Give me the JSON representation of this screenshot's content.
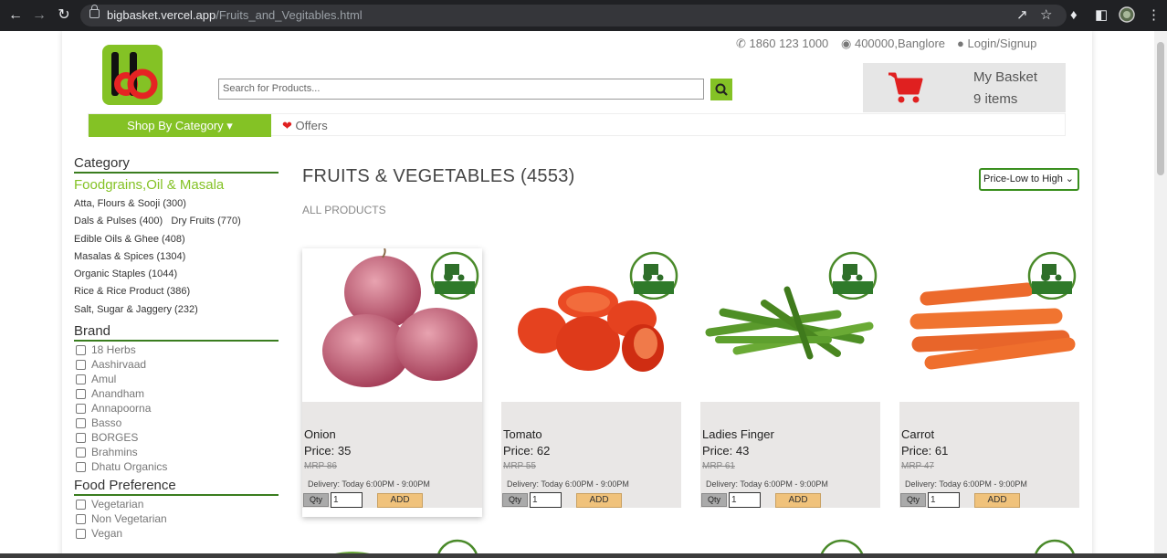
{
  "browser": {
    "url_domain": "bigbasket.vercel.app",
    "url_path": "/Fruits_and_Vegitables.html"
  },
  "header": {
    "phone": "1860 123 1000",
    "location": "400000,Banglore",
    "login": "Login/Signup",
    "search_placeholder": "Search for Products...",
    "basket_title": "My Basket",
    "basket_items": "9 items"
  },
  "nav": {
    "shop_by_category": "Shop By Category",
    "offers": "Offers"
  },
  "sidebar": {
    "category_heading": "Category",
    "category_group": "Foodgrains,Oil & Masala",
    "categories": [
      "Atta, Flours & Sooji (300)",
      "Dals & Pulses (400)",
      "Dry Fruits (770)",
      "Edible Oils & Ghee (408)",
      "Masalas & Spices (1304)",
      "Organic Staples (1044)",
      "Rice & Rice Product (386)",
      "Salt, Sugar & Jaggery (232)"
    ],
    "brand_heading": "Brand",
    "brands": [
      "18 Herbs",
      "Aashirvaad",
      "Amul",
      "Anandham",
      "Annapoorna",
      "Basso",
      "BORGES",
      "Brahmins",
      "Dhatu Organics"
    ],
    "food_pref_heading": "Food Preference",
    "food_prefs": [
      "Vegetarian",
      "Non Vegetarian",
      "Vegan"
    ]
  },
  "main": {
    "title": "FRUITS & VEGETABLES (4553)",
    "subtitle": "ALL PRODUCTS",
    "sort_selected": "Price-Low to High"
  },
  "products": [
    {
      "name": "Onion",
      "price": "Price: 35",
      "mrp": "MRP 86",
      "delivery": "Delivery: Today 6:00PM - 9:00PM",
      "qty_label": "Qty",
      "qty": "1",
      "add": "ADD"
    },
    {
      "name": "Tomato",
      "price": "Price: 62",
      "mrp": "MRP 55",
      "delivery": "Delivery: Today 6:00PM - 9:00PM",
      "qty_label": "Qty",
      "qty": "1",
      "add": "ADD"
    },
    {
      "name": "Ladies Finger",
      "price": "Price: 43",
      "mrp": "MRP 61",
      "delivery": "Delivery: Today 6:00PM - 9:00PM",
      "qty_label": "Qty",
      "qty": "1",
      "add": "ADD"
    },
    {
      "name": "Carrot",
      "price": "Price: 61",
      "mrp": "MRP 47",
      "delivery": "Delivery: Today 6:00PM - 9:00PM",
      "qty_label": "Qty",
      "qty": "1",
      "add": "ADD"
    }
  ],
  "colors": {
    "brand_green": "#84c225",
    "info_bg": "#e9e7e6",
    "add_button": "#f0c27b",
    "cart_red": "#e02020"
  },
  "icons": [
    "back-icon",
    "forward-icon",
    "reload-icon",
    "lock-icon",
    "share-icon",
    "star-icon",
    "extensions-icon",
    "sidebar-icon",
    "profile-icon",
    "menu-icon",
    "phone-icon",
    "location-icon",
    "user-icon",
    "search-icon",
    "cart-icon",
    "tag-icon",
    "caret-down-icon"
  ]
}
